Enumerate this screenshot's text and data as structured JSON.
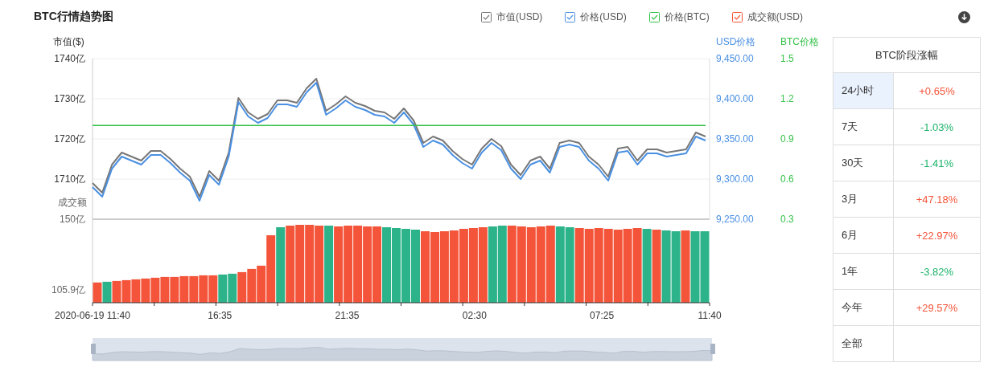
{
  "title": "BTC行情趋势图",
  "legend": [
    {
      "checked": true
    },
    {
      "checked": true
    },
    {
      "checked": true
    },
    {
      "checked": true
    }
  ],
  "price_chart": {
    "chart_data": {
      "type": "line",
      "grid": true,
      "ylabel": "市值($)",
      "ylim": [
        1700,
        1740
      ],
      "yticks": [
        {
          "value": 1740,
          "label": "1740亿"
        },
        {
          "value": 1730,
          "label": "1730亿"
        },
        {
          "value": 1720,
          "label": "1720亿"
        },
        {
          "value": 1710,
          "label": "1710亿"
        }
      ],
      "y2label": "USD价格",
      "y2lim": [
        9250,
        9450
      ],
      "y2ticks": [
        {
          "value": 9450,
          "label": "9,450.00"
        },
        {
          "value": 9400,
          "label": "9,400.00"
        },
        {
          "value": 9350,
          "label": "9,350.00"
        },
        {
          "value": 9300,
          "label": "9,300.00"
        },
        {
          "value": 9250,
          "label": "9,250.00"
        }
      ],
      "y3label": "BTC价格",
      "y3lim": [
        0.3,
        1.5
      ],
      "y3ticks": [
        {
          "value": 1.5,
          "label": "1.5"
        },
        {
          "value": 1.2,
          "label": "1.2"
        },
        {
          "value": 0.9,
          "label": "0.9"
        },
        {
          "value": 0.6,
          "label": "0.6"
        },
        {
          "value": 0.3,
          "label": "0.3"
        }
      ],
      "series": [
        {
          "name": "市值(USD)",
          "color": "#777777",
          "values": [
            1709.0,
            1706.6,
            1713.6,
            1716.6,
            1715.6,
            1714.6,
            1717.0,
            1717.0,
            1715.0,
            1712.6,
            1710.6,
            1705.6,
            1712.0,
            1709.6,
            1716.6,
            1730.2,
            1726.6,
            1725.0,
            1726.2,
            1729.6,
            1729.6,
            1729.0,
            1732.6,
            1735.0,
            1727.0,
            1728.6,
            1730.6,
            1729.0,
            1728.2,
            1727.0,
            1726.6,
            1725.0,
            1727.6,
            1724.6,
            1719.0,
            1720.6,
            1719.6,
            1717.0,
            1715.0,
            1713.6,
            1717.6,
            1720.0,
            1718.2,
            1713.6,
            1711.0,
            1714.6,
            1715.6,
            1712.6,
            1719.0,
            1719.6,
            1719.0,
            1715.6,
            1713.6,
            1710.6,
            1717.6,
            1718.0,
            1714.6,
            1717.4,
            1717.4,
            1716.6,
            1717.0,
            1717.4,
            1721.6,
            1720.6
          ]
        },
        {
          "name": "价格(USD)",
          "color": "#4a90e2",
          "axis": "y2",
          "values": [
            9290,
            9278,
            9313,
            9328,
            9323,
            9318,
            9330,
            9330,
            9320,
            9308,
            9298,
            9273,
            9305,
            9293,
            9328,
            9396,
            9378,
            9370,
            9376,
            9393,
            9393,
            9390,
            9408,
            9420,
            9380,
            9388,
            9398,
            9390,
            9386,
            9380,
            9378,
            9370,
            9383,
            9368,
            9340,
            9348,
            9343,
            9330,
            9320,
            9313,
            9333,
            9345,
            9336,
            9313,
            9300,
            9318,
            9323,
            9308,
            9340,
            9343,
            9340,
            9323,
            9313,
            9298,
            9333,
            9335,
            9318,
            9332,
            9332,
            9328,
            9330,
            9332,
            9353,
            9348
          ]
        },
        {
          "name": "价格(BTC)",
          "color": "#35c24a",
          "axis": "y3",
          "values": [
            1.0,
            1.0,
            1.0,
            1.0,
            1.0,
            1.0,
            1.0,
            1.0,
            1.0,
            1.0,
            1.0,
            1.0,
            1.0,
            1.0,
            1.0,
            1.0,
            1.0,
            1.0,
            1.0,
            1.0,
            1.0,
            1.0,
            1.0,
            1.0,
            1.0,
            1.0,
            1.0,
            1.0,
            1.0,
            1.0,
            1.0,
            1.0,
            1.0,
            1.0,
            1.0,
            1.0,
            1.0,
            1.0,
            1.0,
            1.0,
            1.0,
            1.0,
            1.0,
            1.0,
            1.0,
            1.0,
            1.0,
            1.0,
            1.0,
            1.0,
            1.0,
            1.0,
            1.0,
            1.0,
            1.0,
            1.0,
            1.0,
            1.0,
            1.0,
            1.0,
            1.0,
            1.0,
            1.0,
            1.0
          ]
        }
      ]
    }
  },
  "volume_chart": {
    "chart_data": {
      "type": "bar",
      "categories": [
        "2020-06-19 11:40",
        null,
        null,
        null,
        null,
        null,
        null,
        null,
        null,
        null,
        null,
        null,
        null,
        "16:35",
        null,
        null,
        null,
        null,
        null,
        null,
        null,
        null,
        null,
        null,
        null,
        null,
        "21:35",
        null,
        null,
        null,
        null,
        null,
        null,
        null,
        null,
        null,
        null,
        null,
        null,
        "02:30",
        null,
        null,
        null,
        null,
        null,
        null,
        null,
        null,
        null,
        null,
        null,
        null,
        "07:25",
        null,
        null,
        null,
        null,
        null,
        null,
        null,
        null,
        null,
        null,
        "11:40"
      ],
      "ylabel": "成交额",
      "ylim": [
        97.9,
        150
      ],
      "yticks": [
        {
          "value": 150,
          "label": "150亿"
        },
        {
          "value": 105.9,
          "label": "105.9亿"
        }
      ],
      "series": [
        {
          "name": "成交额(USD)",
          "color": "#f4553a",
          "values": [
            110.5,
            null,
            111.5,
            112,
            112.5,
            113,
            113.5,
            114,
            114,
            114.5,
            114.5,
            115,
            115,
            null,
            null,
            117,
            119,
            121,
            140,
            null,
            146,
            146.5,
            146.5,
            146,
            null,
            145.5,
            146,
            146,
            145.5,
            145.5,
            null,
            null,
            null,
            null,
            142.5,
            142,
            142.5,
            143,
            144,
            144.5,
            145,
            null,
            null,
            146,
            145.5,
            145,
            145.5,
            146,
            null,
            null,
            144.5,
            144,
            144.5,
            144,
            143.5,
            144,
            144.5,
            null,
            143.5,
            null,
            null,
            143,
            null,
            null
          ]
        },
        {
          "color": "#2db38a",
          "values": [
            null,
            111,
            null,
            null,
            null,
            null,
            null,
            null,
            null,
            null,
            null,
            null,
            null,
            115.5,
            116,
            null,
            null,
            null,
            null,
            145,
            null,
            null,
            null,
            null,
            146,
            null,
            null,
            null,
            null,
            null,
            145,
            144.5,
            144,
            143.5,
            null,
            null,
            null,
            null,
            null,
            null,
            null,
            145.5,
            146,
            null,
            null,
            null,
            null,
            null,
            145.5,
            145,
            null,
            null,
            null,
            null,
            null,
            null,
            null,
            144,
            null,
            143,
            142.5,
            null,
            142.5,
            142.5
          ]
        }
      ]
    }
  },
  "range_slider": {
    "level": 1
  },
  "performance": {
    "title": "BTC阶段涨幅",
    "rows": [
      {
        "label": "24小时",
        "value": "+0.65%",
        "color": "#f4553a",
        "selected": true
      },
      {
        "label": "7天",
        "value": "-1.03%",
        "color": "#1db36b",
        "selected": false
      },
      {
        "label": "30天",
        "value": "-1.41%",
        "color": "#1db36b",
        "selected": false
      },
      {
        "label": "3月",
        "value": "+47.18%",
        "color": "#f4553a",
        "selected": false
      },
      {
        "label": "6月",
        "value": "+22.97%",
        "color": "#f4553a",
        "selected": false
      },
      {
        "label": "1年",
        "value": "-3.82%",
        "color": "#1db36b",
        "selected": false
      },
      {
        "label": "今年",
        "value": "+29.57%",
        "color": "#f4553a",
        "selected": false
      },
      {
        "label": "全部",
        "selected": false
      }
    ]
  }
}
